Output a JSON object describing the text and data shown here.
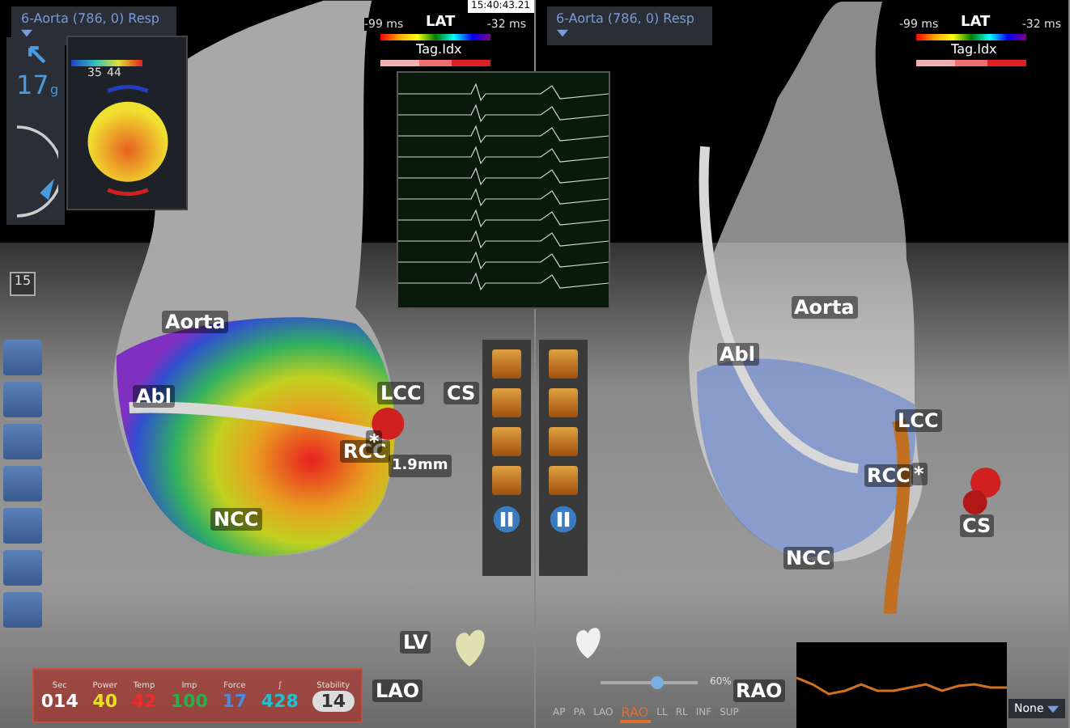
{
  "left_view": {
    "dropdown": "6-Aorta (786, 0) Resp",
    "timestamp": "15:40:43.21",
    "lat_legend": {
      "min": "-99 ms",
      "title": "LAT",
      "max": "-32 ms",
      "tag": "Tag.Idx"
    },
    "force_widget": {
      "value": "17",
      "unit": "g",
      "range_low": "35",
      "range_high": "44"
    },
    "counter": "15",
    "labels": [
      {
        "text": "Aorta"
      },
      {
        "text": "Abl"
      },
      {
        "text": "LCC"
      },
      {
        "text": "CS"
      },
      {
        "text": "RCC"
      },
      {
        "text": "NCC"
      },
      {
        "text": "*"
      },
      {
        "text": "1.9mm"
      },
      {
        "text": "LV"
      },
      {
        "text": "LAO"
      }
    ]
  },
  "stats": [
    {
      "label": "Sec",
      "value": "014",
      "color": "#ffffff"
    },
    {
      "label": "Power",
      "value": "40",
      "color": "#e8e020"
    },
    {
      "label": "Temp",
      "value": "42",
      "color": "#f02a2a"
    },
    {
      "label": "Imp",
      "value": "100",
      "color": "#2ab04a"
    },
    {
      "label": "Force",
      "value": "17",
      "color": "#4a8ae0"
    },
    {
      "label": "∫",
      "value": "428",
      "color": "#20c0d0"
    },
    {
      "label": "Stability",
      "value": "14",
      "color": "#333333"
    }
  ],
  "right_view": {
    "dropdown": "6-Aorta (786, 0) Resp",
    "lat_legend": {
      "min": "-99 ms",
      "title": "LAT",
      "max": "-32 ms",
      "tag": "Tag.Idx"
    },
    "labels": [
      {
        "text": "Aorta"
      },
      {
        "text": "Abl"
      },
      {
        "text": "LCC"
      },
      {
        "text": "RCC"
      },
      {
        "text": "NCC"
      },
      {
        "text": "CS"
      },
      {
        "text": "*"
      },
      {
        "text": "RAO"
      }
    ],
    "view_buttons": [
      {
        "label": "AP",
        "selected": false
      },
      {
        "label": "PA",
        "selected": false
      },
      {
        "label": "LAO",
        "selected": false
      },
      {
        "label": "RAO",
        "selected": true
      },
      {
        "label": "LL",
        "selected": false
      },
      {
        "label": "RL",
        "selected": false
      },
      {
        "label": "INF",
        "selected": false
      },
      {
        "label": "SUP",
        "selected": false
      }
    ],
    "zoom": "60%",
    "zoom_slider": {
      "level": 0.6
    },
    "filter": "None"
  }
}
